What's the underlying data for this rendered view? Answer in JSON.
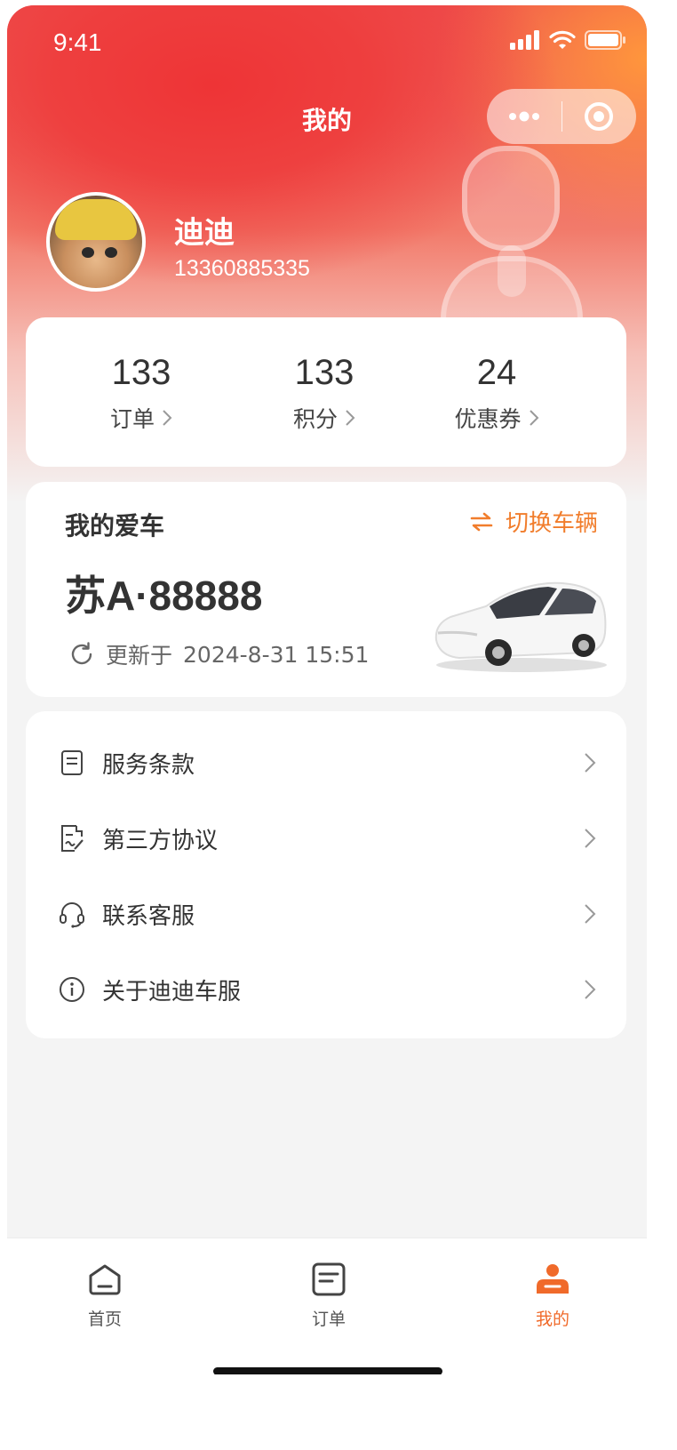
{
  "status_bar": {
    "time": "9:41"
  },
  "nav": {
    "title": "我的"
  },
  "user": {
    "name": "迪迪",
    "phone": "13360885335"
  },
  "stats": [
    {
      "value": "133",
      "label": "订单"
    },
    {
      "value": "133",
      "label": "积分"
    },
    {
      "value": "24",
      "label": "优惠券"
    }
  ],
  "car": {
    "title": "我的爱车",
    "switch_label": "切换车辆",
    "plate": "苏A·88888",
    "updated_label": "更新于",
    "updated_time": "2024-8-31 15:51"
  },
  "menu": [
    {
      "label": "服务条款",
      "icon": "document-icon"
    },
    {
      "label": "第三方协议",
      "icon": "agreement-icon"
    },
    {
      "label": "联系客服",
      "icon": "headset-icon"
    },
    {
      "label": "关于迪迪车服",
      "icon": "info-icon"
    }
  ],
  "tabs": [
    {
      "label": "首页",
      "icon": "home-icon"
    },
    {
      "label": "订单",
      "icon": "order-icon"
    },
    {
      "label": "我的",
      "icon": "profile-icon",
      "active": true
    }
  ],
  "colors": {
    "accent": "#f06a2a",
    "hero_red": "#ee4040",
    "hero_orange": "#ff9640"
  }
}
